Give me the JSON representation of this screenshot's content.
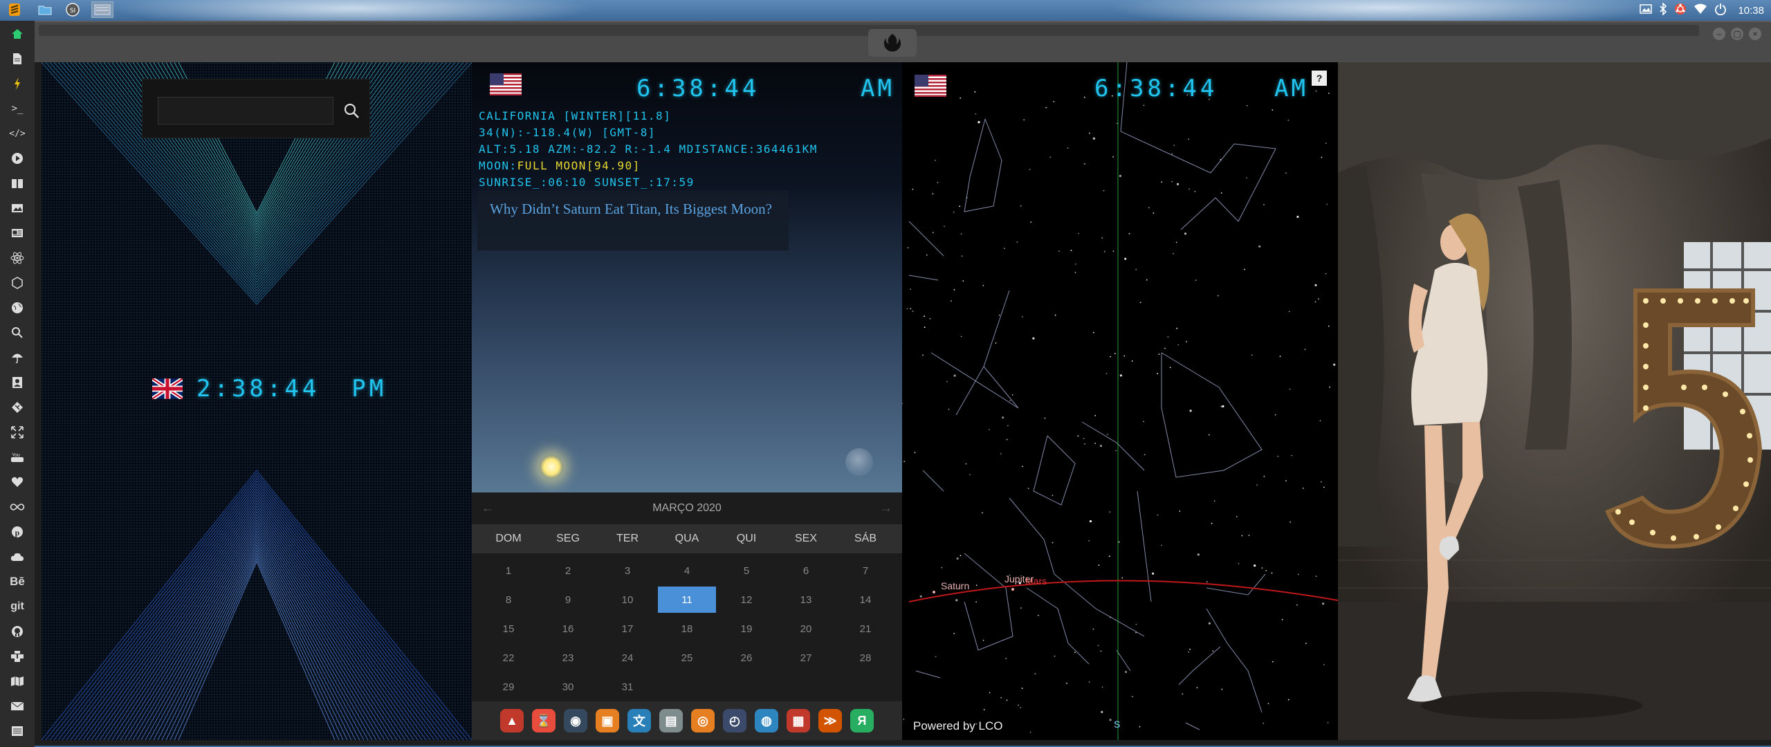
{
  "topbar": {
    "clock": "10:38",
    "launchers": [
      "sublime-text-icon",
      "folder-icon",
      "system-icon",
      "desktop-thumb-icon"
    ],
    "tray_icons": [
      "image-icon",
      "bluetooth-icon",
      "ubuntu-icon",
      "wifi-icon",
      "power-icon"
    ]
  },
  "leftdock": {
    "icons": [
      "home-icon",
      "document-icon",
      "flash-icon",
      "terminal-icon",
      "code-icon",
      "play-icon",
      "book-icon",
      "image-icon",
      "newspaper-icon",
      "react-icon",
      "network-icon",
      "globe-icon",
      "search-icon",
      "umbrella-icon",
      "contact-icon",
      "git-diamond-icon",
      "expand-icon",
      "youtube-icon",
      "heart-icon",
      "infinity-icon",
      "pinterest-icon",
      "cloud-icon",
      "behance-icon",
      "git-icon",
      "github-icon",
      "puzzle-icon",
      "map-icon",
      "mail-icon",
      "list-icon"
    ],
    "text_icons": {
      "behance": "Bē",
      "git": "git"
    }
  },
  "panel_uk": {
    "search_placeholder": "",
    "time": "2:38:44",
    "ampm": "PM"
  },
  "panel_ca": {
    "time": "6:38:44",
    "ampm": "AM",
    "info": {
      "line1": "CALIFORNIA [WINTER][11.8]",
      "line2": "34(N):-118.4(W) [GMT-8]",
      "line3": "ALT:5.18 AZM:-82.2 R:-1.4 MDISTANCE:364461KM",
      "moon_label": "MOON:",
      "moon_value": "FULL MOON[94.90]",
      "line5": "SUNRISE_:06:10 SUNSET_:17:59"
    },
    "news_title": "Why Didn’t Saturn Eat Titan, Its Biggest Moon?"
  },
  "calendar": {
    "month": "MARÇO 2020",
    "prev": "←",
    "next": "→",
    "weekdays": [
      "DOM",
      "SEG",
      "TER",
      "QUA",
      "QUI",
      "SEX",
      "SÁB"
    ],
    "days": [
      "1",
      "2",
      "3",
      "4",
      "5",
      "6",
      "7",
      "8",
      "9",
      "10",
      "11",
      "12",
      "13",
      "14",
      "15",
      "16",
      "17",
      "18",
      "19",
      "20",
      "21",
      "22",
      "23",
      "24",
      "25",
      "26",
      "27",
      "28",
      "29",
      "30",
      "31"
    ],
    "today": "11"
  },
  "dock_apps": [
    {
      "name": "app-red-triangle-icon",
      "glyph": "▲",
      "color": "#c0392b"
    },
    {
      "name": "app-hourglass-icon",
      "glyph": "⌛",
      "color": "#e74c3c"
    },
    {
      "name": "app-globe-dark-icon",
      "glyph": "◉",
      "color": "#34495e"
    },
    {
      "name": "app-image-viewer-icon",
      "glyph": "▣",
      "color": "#e67e22"
    },
    {
      "name": "app-translator-icon",
      "glyph": "文",
      "color": "#2980b9"
    },
    {
      "name": "app-window-icon",
      "glyph": "▤",
      "color": "#7f8c8d"
    },
    {
      "name": "app-search-icon",
      "glyph": "◎",
      "color": "#e67e22"
    },
    {
      "name": "app-clock-icon",
      "glyph": "◴",
      "color": "#3b4a6b"
    },
    {
      "name": "app-browser-icon",
      "glyph": "◍",
      "color": "#2e86c1"
    },
    {
      "name": "app-calendar-icon",
      "glyph": "▦",
      "color": "#c0392b"
    },
    {
      "name": "app-terminal-icon",
      "glyph": "≫",
      "color": "#d35400"
    },
    {
      "name": "app-yandex-icon",
      "glyph": "Я",
      "color": "#27ae60"
    }
  ],
  "panel_sky": {
    "time": "6:38:44",
    "ampm": "AM",
    "help": "?",
    "planets": [
      "Saturn",
      "Jupiter",
      "Mars"
    ],
    "south_marker": "S",
    "powered_by": "Powered by LCO"
  }
}
